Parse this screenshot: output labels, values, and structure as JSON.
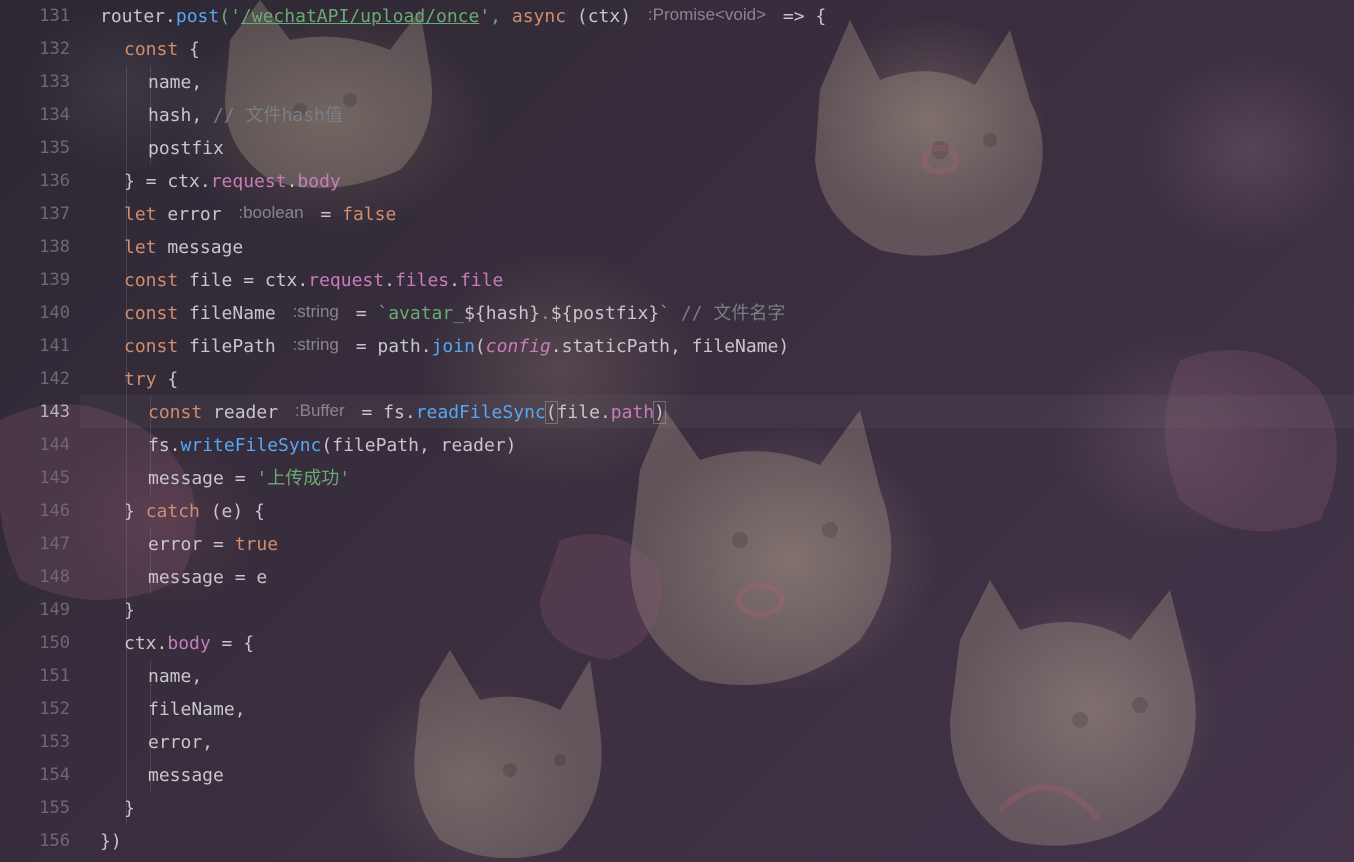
{
  "editor": {
    "line_numbers": [
      "131",
      "132",
      "133",
      "134",
      "135",
      "136",
      "137",
      "138",
      "139",
      "140",
      "141",
      "142",
      "143",
      "144",
      "145",
      "146",
      "147",
      "148",
      "149",
      "150",
      "151",
      "152",
      "153",
      "154",
      "155",
      "156"
    ],
    "current_line": "143",
    "lines": {
      "l131": {
        "a": "router",
        "b": ".",
        "c": "post",
        "d": "('",
        "e": "/wechatAPI/upload/once",
        "f": "', ",
        "g": "async",
        "h": " (ctx) ",
        "hint": ":Promise<void>",
        "i": " => {"
      },
      "l132": {
        "a": "const",
        "b": " {"
      },
      "l133": {
        "a": "name,"
      },
      "l134": {
        "a": "hash, ",
        "b": "// 文件hash值"
      },
      "l135": {
        "a": "postfix"
      },
      "l136": {
        "a": "} = ctx.",
        "b": "request",
        "c": ".",
        "d": "body"
      },
      "l137": {
        "a": "let",
        "b": " error ",
        "hint": ":boolean",
        "c": " = ",
        "d": "false"
      },
      "l138": {
        "a": "let",
        "b": " message"
      },
      "l139": {
        "a": "const",
        "b": " file = ctx.",
        "c": "request",
        "d": ".",
        "e": "files",
        "f": ".",
        "g": "file"
      },
      "l140": {
        "a": "const",
        "b": " fileName ",
        "hint": ":string",
        "c": " = ",
        "d": "`avatar_",
        "e": "${hash}",
        "f": ".",
        "g": "${postfix}",
        "h": "`",
        "i": " // 文件名字"
      },
      "l141": {
        "a": "const",
        "b": " filePath ",
        "hint": ":string",
        "c": " = path.",
        "d": "join",
        "e": "(",
        "f": "config",
        "g": ".staticPath, fileName)"
      },
      "l142": {
        "a": "try",
        "b": " {"
      },
      "l143": {
        "a": "const",
        "b": " reader ",
        "hint": ":Buffer",
        "c": " = fs.",
        "d": "readFileSync",
        "e": "(",
        "f": "file.",
        "g": "path",
        "h": ")"
      },
      "l144": {
        "a": "fs.",
        "b": "writeFileSync",
        "c": "(filePath, reader)"
      },
      "l145": {
        "a": "message = ",
        "b": "'上传成功'"
      },
      "l146": {
        "a": "} ",
        "b": "catch",
        "c": " (e) {"
      },
      "l147": {
        "a": "error = ",
        "b": "true"
      },
      "l148": {
        "a": "message = e"
      },
      "l149": {
        "a": "}"
      },
      "l150": {
        "a": "ctx.",
        "b": "body",
        "c": " = {"
      },
      "l151": {
        "a": "name,"
      },
      "l152": {
        "a": "fileName,"
      },
      "l153": {
        "a": "error,"
      },
      "l154": {
        "a": "message"
      },
      "l155": {
        "a": "}"
      },
      "l156": {
        "a": "})"
      }
    }
  },
  "colors": {
    "keyword": "#cf8e6d",
    "function": "#56a8f5",
    "string": "#6aab73",
    "property": "#c77dbb",
    "comment": "#7a7e85",
    "text": "#c9c5cc",
    "gutter": "#6f6875"
  }
}
